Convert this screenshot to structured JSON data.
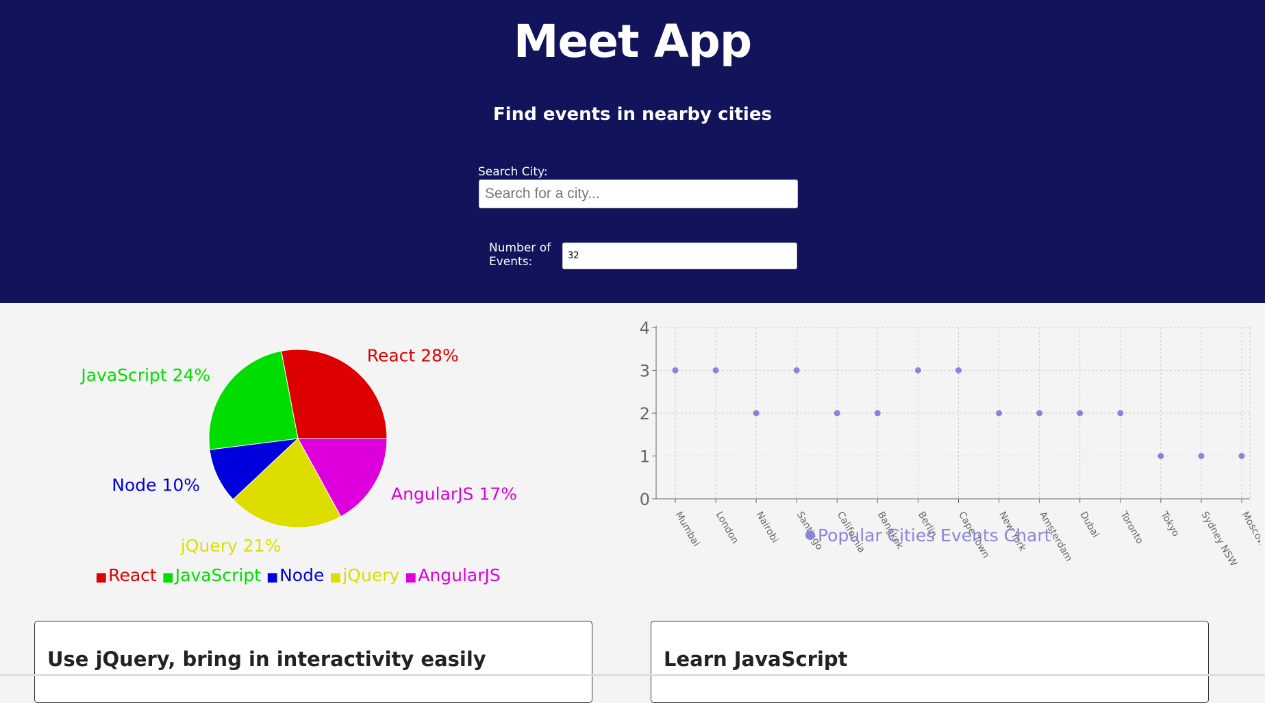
{
  "header": {
    "title": "Meet App",
    "subtitle": "Find events in nearby cities"
  },
  "search": {
    "label": "Search City:",
    "placeholder": "Search for a city...",
    "value": ""
  },
  "events": {
    "label": "Number of Events:",
    "value": "32"
  },
  "colors": {
    "header_bg": "#11135b",
    "react": "#dd0000",
    "javascript": "#00dd00",
    "node": "#0000dd",
    "jquery": "#dddd00",
    "angularjs": "#dd00dd",
    "scatter": "#8884d8"
  },
  "chart_data": [
    {
      "type": "pie",
      "slices": [
        {
          "name": "React",
          "value": 28,
          "label": "React 28%",
          "color": "#dd0000"
        },
        {
          "name": "AngularJS",
          "value": 17,
          "label": "AngularJS 17%",
          "color": "#dd00dd"
        },
        {
          "name": "jQuery",
          "value": 21,
          "label": "jQuery 21%",
          "color": "#dddd00"
        },
        {
          "name": "Node",
          "value": 10,
          "label": "Node 10%",
          "color": "#0000dd"
        },
        {
          "name": "JavaScript",
          "value": 24,
          "label": "JavaScript 24%",
          "color": "#00dd00"
        }
      ],
      "legend": [
        "React",
        "JavaScript",
        "Node",
        "jQuery",
        "AngularJS"
      ],
      "legend_placement": "bottom"
    },
    {
      "type": "scatter",
      "categories": [
        "Mumbai",
        "London",
        "Nairobi",
        "Santiago",
        "California",
        "Bangkok",
        "Berlin",
        "Cape Town",
        "New York",
        "Amsterdam",
        "Dubai",
        "Toronto",
        "Tokyo",
        "Sydney NSW",
        "Moscow"
      ],
      "values": [
        3,
        3,
        2,
        3,
        2,
        2,
        3,
        3,
        2,
        2,
        2,
        2,
        1,
        1,
        1
      ],
      "ylim": [
        0,
        4
      ],
      "yticks": [
        0,
        1,
        2,
        3,
        4
      ],
      "grid": true,
      "legend": "Popular Cities Events Chart",
      "legend_placement": "bottom"
    }
  ],
  "cards": [
    {
      "title": "Use jQuery, bring in interactivity easily"
    },
    {
      "title": "Learn JavaScript"
    }
  ]
}
